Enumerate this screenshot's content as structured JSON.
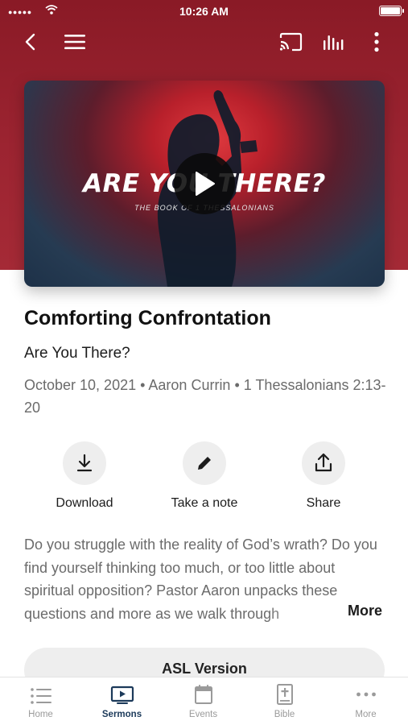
{
  "status_bar": {
    "signal": "●●●●●",
    "time": "10:26 AM"
  },
  "top_nav": {
    "back_icon": "chevron-left-icon",
    "menu_icon": "hamburger-icon",
    "cast_icon": "cast-icon",
    "audio_icon": "audio-bars-icon",
    "more_icon": "vertical-dots-icon"
  },
  "video": {
    "series_title": "ARE YOU THERE?",
    "series_subtitle": "THE BOOK OF 1 THESSALONIANS",
    "play_icon": "play-icon"
  },
  "sermon": {
    "title": "Comforting Confrontation",
    "series": "Are You There?",
    "meta": "October 10, 2021 • Aaron Currin • 1 Thessalonians 2:13-20"
  },
  "actions": [
    {
      "label": "Download",
      "icon": "download-icon"
    },
    {
      "label": "Take a note",
      "icon": "pencil-icon"
    },
    {
      "label": "Share",
      "icon": "share-icon"
    }
  ],
  "description": {
    "text": "Do you struggle with the reality of God’s wrath? Do you find yourself thinking too much, or too little about spiritual opposition? Pastor Aaron unpacks these questions and more as we walk through",
    "more_label": "More"
  },
  "asl_button": {
    "label": "ASL Version"
  },
  "tabs": [
    {
      "label": "Home",
      "icon": "list-icon",
      "active": false
    },
    {
      "label": "Sermons",
      "icon": "tv-play-icon",
      "active": true
    },
    {
      "label": "Events",
      "icon": "calendar-icon",
      "active": false
    },
    {
      "label": "Bible",
      "icon": "bible-icon",
      "active": false
    },
    {
      "label": "More",
      "icon": "horizontal-dots-icon",
      "active": false
    }
  ],
  "colors": {
    "brand": "#9c2431",
    "active_tab": "#1c3a5a",
    "muted": "#6b6b6b"
  }
}
